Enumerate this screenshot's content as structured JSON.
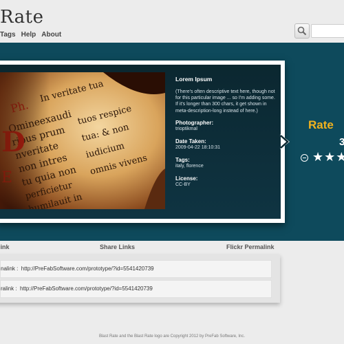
{
  "header": {
    "logo_text": "Rate",
    "nav": [
      "Tags",
      "Help",
      "About"
    ],
    "search": {
      "icon": "magnifier-icon",
      "placeholder": ""
    }
  },
  "photo_card": {
    "title": "Lorem Ipsum",
    "description": "(There's often descriptive text here, though not for this particular image ... so I'm adding some. If it's longer than 300 chars, it get shown in meta-description-long instead of here.)",
    "photographer_label": "Photographer:",
    "photographer": "trioptikmal",
    "date_label": "Date Taken:",
    "date": "2009-04-22 18:10:31",
    "tags_label": "Tags:",
    "tags": "italy, florence",
    "license_label": "License:",
    "license": "CC-BY",
    "next_icon": "chevron-right-icon"
  },
  "rate_panel": {
    "title": "Rate",
    "number": "3",
    "minus_icon": "minus-circle-icon",
    "stars_filled": 3
  },
  "links": {
    "headers": [
      "link",
      "Share Links",
      "Flickr Permalink"
    ],
    "rows": [
      {
        "label": "nalink",
        "url": "http://PreFabSoftware.com/prototype/?id=5541420739"
      },
      {
        "label": "ralink",
        "url": "http://PreFabSoftware.com/prototype/?id=5541420739"
      }
    ]
  },
  "footer": "Blast Rate and the Blast Rate logo are Copyright 2012 by PreFab Software, Inc.",
  "colors": {
    "band": "#0e4a5c",
    "accent": "#f2b21e",
    "background": "#ececec"
  }
}
